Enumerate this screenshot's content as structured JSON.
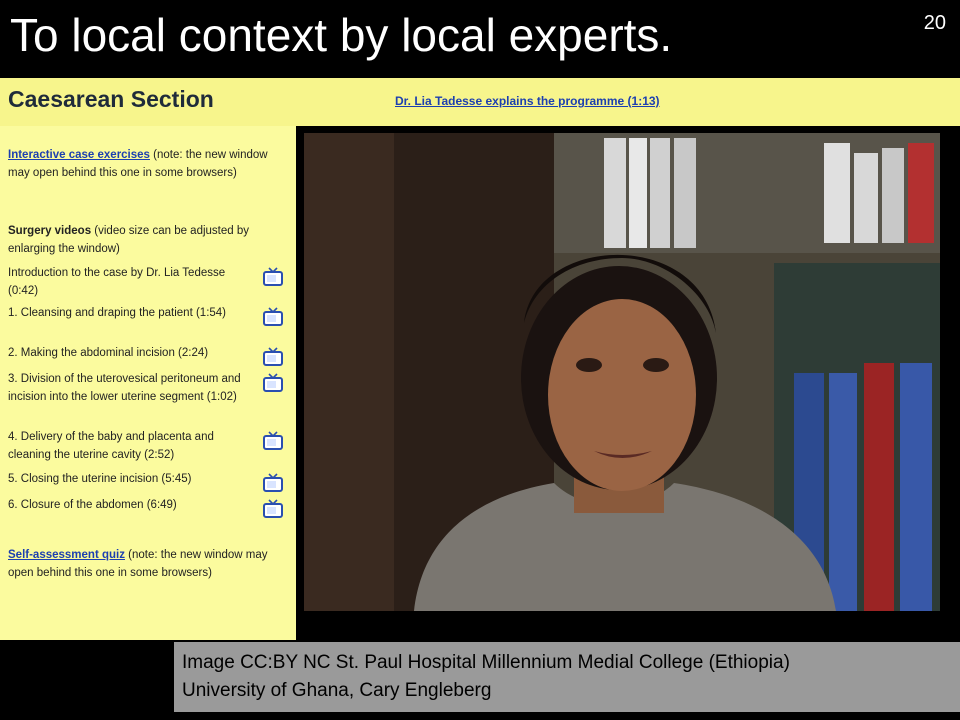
{
  "slide": {
    "title": "To local context by local experts.",
    "number": "20"
  },
  "course": {
    "title": "Caesarean Section",
    "header_link": "Dr. Lia Tadesse explains the programme (1:13)"
  },
  "panel": {
    "case_link": "Interactive case exercises",
    "case_note": " (note: the new window may open behind this one in some browsers)",
    "surgery_heading": "Surgery videos",
    "surgery_note": " (video size can be adjusted by enlarging the window)",
    "videos": [
      {
        "label": "Introduction to the case by Dr. Lia Tedesse (0:42)"
      },
      {
        "label": "1. Cleansing and draping the patient (1:54)"
      },
      {
        "label": "2. Making the abdominal incision (2:24)"
      },
      {
        "label": "3. Division of the uterovesical peritoneum and incision into the lower uterine segment (1:02)"
      },
      {
        "label": "4. Delivery of the baby and placenta and cleaning the uterine cavity (2:52)"
      },
      {
        "label": "5. Closing the uterine incision (5:45)"
      },
      {
        "label": "6. Closure of the abdomen (6:49)"
      }
    ],
    "quiz_link": "Self-assessment quiz",
    "quiz_note": " (note: the new window may open behind this one in some browsers)"
  },
  "caption": {
    "line1": "Image CC:BY NC St. Paul Hospital Millennium Medial College (Ethiopia)",
    "line2": "University of Ghana, Cary Engleberg"
  },
  "colors": {
    "header_yellow": "#f7f58c",
    "panel_yellow": "#fbfb9e",
    "link_blue": "#1c3fb0",
    "caption_gray": "#9a9a9a"
  },
  "icons": {
    "video": "tv-icon"
  }
}
